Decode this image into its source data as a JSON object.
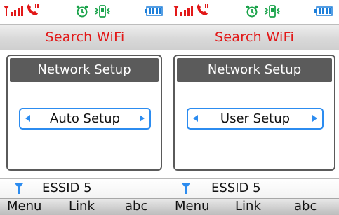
{
  "colors": {
    "title_text": "#e21818",
    "panel_header_bg": "#5b5b5b",
    "selector_border": "#2c8cf0",
    "signal_icon": "#e21818",
    "call_icon": "#e21818",
    "status_icons": "#1aa34a",
    "battery_icon": "#1d7fda",
    "antenna_icon": "#2c8cf0"
  },
  "screens": [
    {
      "status_icons": [
        "signal-bars-icon",
        "call-icon",
        "alarm-clock-icon",
        "vibrate-icon",
        "battery-icon"
      ],
      "title": "Search WiFi",
      "panel_header": "Network Setup",
      "selector_value": "Auto Setup",
      "ssid": "ESSID 5",
      "softkeys": {
        "left": "Menu",
        "center": "Link",
        "right": "abc"
      }
    },
    {
      "status_icons": [
        "signal-bars-icon",
        "call-icon",
        "alarm-clock-icon",
        "vibrate-icon",
        "battery-icon"
      ],
      "title": "Search WiFi",
      "panel_header": "Network Setup",
      "selector_value": "User Setup",
      "ssid": "ESSID 5",
      "softkeys": {
        "left": "Menu",
        "center": "Link",
        "right": "abc"
      }
    }
  ]
}
